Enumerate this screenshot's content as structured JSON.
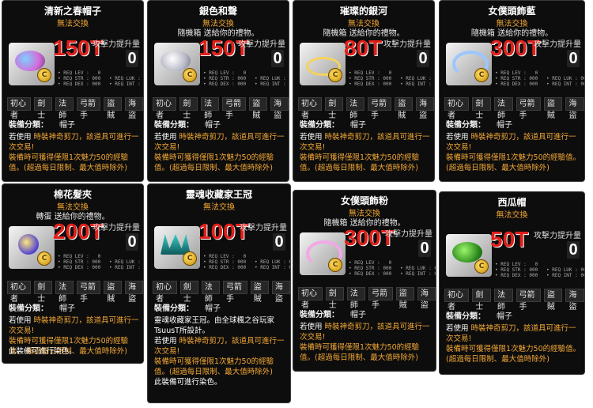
{
  "common": {
    "trade": "無法交換",
    "gift": "隨機箱 送給你的禮物。",
    "atk_label": "攻擊力提升量",
    "atk_value": "0",
    "stats": "• REQ LEV :   0\n• REQ STR : 000   • REQ LUK : 000\n• REQ DEX : 000   • REQ INT : 000",
    "classes": [
      "初心者",
      "劍士",
      "法師",
      "弓箭手",
      "盜賊",
      "海盜"
    ],
    "category_label": "裝備分類：",
    "category_value": "帽子",
    "use_prefix": "若使用",
    "use_text": "時裝神奇剪刀，該道具可進行一次交易!",
    "charm_text": "裝備時可獲得僅限1次魅力50的經驗值。(超過每日限制、最大值時除外)",
    "dye_text": "此裝備可進行染色。",
    "coin_label": "C"
  },
  "items": [
    {
      "name": "清新之春帽子",
      "price": "150T",
      "icon": "pastel-hat-icon"
    },
    {
      "name": "銀色和聲",
      "price": "150T",
      "icon": "silver-harmony-icon"
    },
    {
      "name": "璀璨的銀河",
      "price": "80T",
      "icon": "galaxy-ring-icon"
    },
    {
      "name": "女僕頭飾藍",
      "price": "300T",
      "icon": "maid-headband-blue-icon"
    },
    {
      "name": "棉花髮夾",
      "price": "200T",
      "icon": "cotton-hairpin-icon"
    },
    {
      "name": "靈魂收藏家王冠",
      "price": "100T",
      "icon": "soul-collector-crown-icon",
      "gift": "轉蛋 送給你的禮物。",
      "extra": "靈魂收藏家王冠。由全球楓之谷玩家TsuusT所設計。"
    },
    {
      "name": "女僕頭飾粉",
      "price": "300T",
      "icon": "maid-headband-pink-icon"
    },
    {
      "name": "西瓜帽",
      "price": "50T",
      "icon": "watermelon-hat-icon"
    }
  ],
  "colors": {
    "price": "#e0201b",
    "orange": "#f2a735",
    "bg": "#0d0d0d"
  }
}
